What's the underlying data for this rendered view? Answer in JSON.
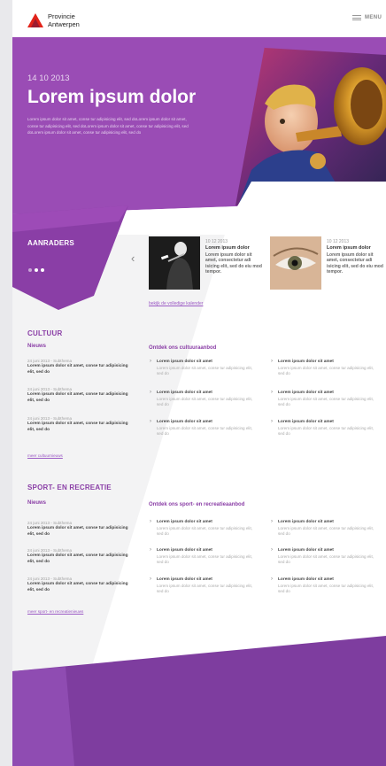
{
  "header": {
    "logo_line1": "Provincie",
    "logo_line2": "Antwerpen",
    "menu_label": "MENU"
  },
  "hero": {
    "date": "14 10 2013",
    "title": "Lorem ipsum dolor",
    "text": "Lorem ipsum dolor sit amet, conse tur adipisicing elit, sed doLorem ipsum dolor sit amet, conse tur adipisicing elit, sed doLorem ipsum dolor sit amet, conse tur adipisicing elit, sed doLorem ipsum dolor sit amet, conse tur adipisicing elit, sed do"
  },
  "aanraders": {
    "title": "AANRADERS",
    "cards": [
      {
        "date": "10 12 2013",
        "title": "Lorem ipsum dolor",
        "text": "Lorem ipsum dolor sit amet, consectetur adi isicing elit, sed do eiu mod tempor."
      },
      {
        "date": "10 12 2013",
        "title": "Lorem ipsum dolor",
        "text": "Lorem ipsum dolor sit amet, consectetur adi isicing elit, sed do eiu mod tempor."
      }
    ],
    "calendar_link": "bekijk de volledige kalender"
  },
  "cultuur": {
    "title": "CULTUUR",
    "news_heading": "Nieuws",
    "news": [
      {
        "date": "24 juni 2013 - Subthema",
        "text": "Lorem ipsum dolor sit amet, conse tur adipisicing elit, sed do"
      },
      {
        "date": "24 juni 2013 - Subthema",
        "text": "Lorem ipsum dolor sit amet, conse tur adipisicing elit, sed do"
      },
      {
        "date": "24 juni 2013 - Subthema",
        "text": "Lorem ipsum dolor sit amet, conse tur adipisicing elit, sed do"
      }
    ],
    "more_link": "meer cultuurnieuws",
    "offer_heading": "Ontdek ons cultuuraanbod",
    "offers": [
      {
        "title": "Lorem ipsum dolor sit amet",
        "text": "Lorem ipsum dolor sit amet, conse tur adipisicing elit, sed do"
      },
      {
        "title": "Lorem ipsum dolor sit amet",
        "text": "Lorem ipsum dolor sit amet, conse tur adipisicing elit, sed do"
      },
      {
        "title": "Lorem ipsum dolor sit amet",
        "text": "Lorem ipsum dolor sit amet, conse tur adipisicing elit, sed do"
      },
      {
        "title": "Lorem ipsum dolor sit amet",
        "text": "Lorem ipsum dolor sit amet, conse tur adipisicing elit, sed do"
      },
      {
        "title": "Lorem ipsum dolor sit amet",
        "text": "Lorem ipsum dolor sit amet, conse tur adipisicing elit, sed do"
      },
      {
        "title": "Lorem ipsum dolor sit amet",
        "text": "Lorem ipsum dolor sit amet, conse tur adipisicing elit, sed do"
      }
    ]
  },
  "sport": {
    "title": "SPORT- EN RECREATIE",
    "news_heading": "Nieuws",
    "news": [
      {
        "date": "24 juni 2013 - Subthema",
        "text": "Lorem ipsum dolor sit amet, conse tur adipisicing elit, sed do"
      },
      {
        "date": "24 juni 2013 - Subthema",
        "text": "Lorem ipsum dolor sit amet, conse tur adipisicing elit, sed do"
      },
      {
        "date": "24 juni 2013 - Subthema",
        "text": "Lorem ipsum dolor sit amet, conse tur adipisicing elit, sed do"
      }
    ],
    "more_link": "meer sport- en recreatienieuws",
    "offer_heading": "Ontdek ons sport- en recreatieaanbod",
    "offers": [
      {
        "title": "Lorem ipsum dolor sit amet",
        "text": "Lorem ipsum dolor sit amet, conse tur adipisicing elit, sed do"
      },
      {
        "title": "Lorem ipsum dolor sit amet",
        "text": "Lorem ipsum dolor sit amet, conse tur adipisicing elit, sed do"
      },
      {
        "title": "Lorem ipsum dolor sit amet",
        "text": "Lorem ipsum dolor sit amet, conse tur adipisicing elit, sed do"
      },
      {
        "title": "Lorem ipsum dolor sit amet",
        "text": "Lorem ipsum dolor sit amet, conse tur adipisicing elit, sed do"
      },
      {
        "title": "Lorem ipsum dolor sit amet",
        "text": "Lorem ipsum dolor sit amet, conse tur adipisicing elit, sed do"
      },
      {
        "title": "Lorem ipsum dolor sit amet",
        "text": "Lorem ipsum dolor sit amet, conse tur adipisicing elit, sed do"
      }
    ]
  },
  "colors": {
    "brand_purple": "#8a3ea6",
    "hero_purple": "#9a4cb5",
    "light_bg": "#f2f2f2",
    "logo_red": "#e2231a"
  }
}
